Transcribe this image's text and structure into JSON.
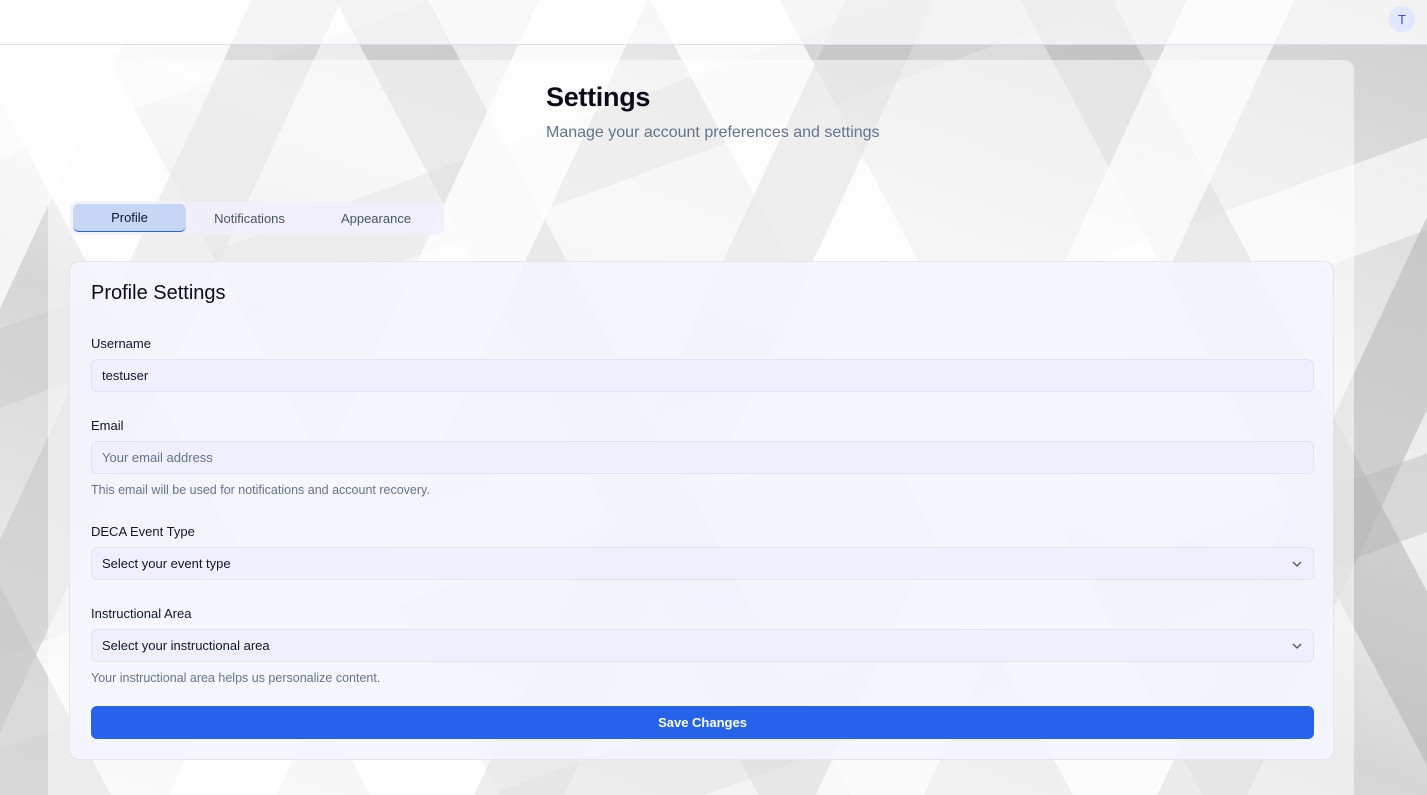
{
  "topbar": {
    "avatar_letter": "T"
  },
  "header": {
    "title": "Settings",
    "subtitle": "Manage your account preferences and settings"
  },
  "tabs": [
    {
      "label": "Profile",
      "active": true
    },
    {
      "label": "Notifications",
      "active": false
    },
    {
      "label": "Appearance",
      "active": false
    }
  ],
  "profile": {
    "card_title": "Profile Settings",
    "username": {
      "label": "Username",
      "value": "testuser"
    },
    "email": {
      "label": "Email",
      "value": "",
      "placeholder": "Your email address",
      "hint": "This email will be used for notifications and account recovery."
    },
    "event_type": {
      "label": "DECA Event Type",
      "selected": "Select your event type"
    },
    "instructional_area": {
      "label": "Instructional Area",
      "selected": "Select your instructional area",
      "hint": "Your instructional area helps us personalize content."
    },
    "save_label": "Save Changes"
  },
  "colors": {
    "accent": "#2563eb",
    "active_tab_bg": "#c7d6f5",
    "muted_text": "#64748b"
  },
  "icons": {
    "select_chevron": "chevron-down-icon"
  }
}
